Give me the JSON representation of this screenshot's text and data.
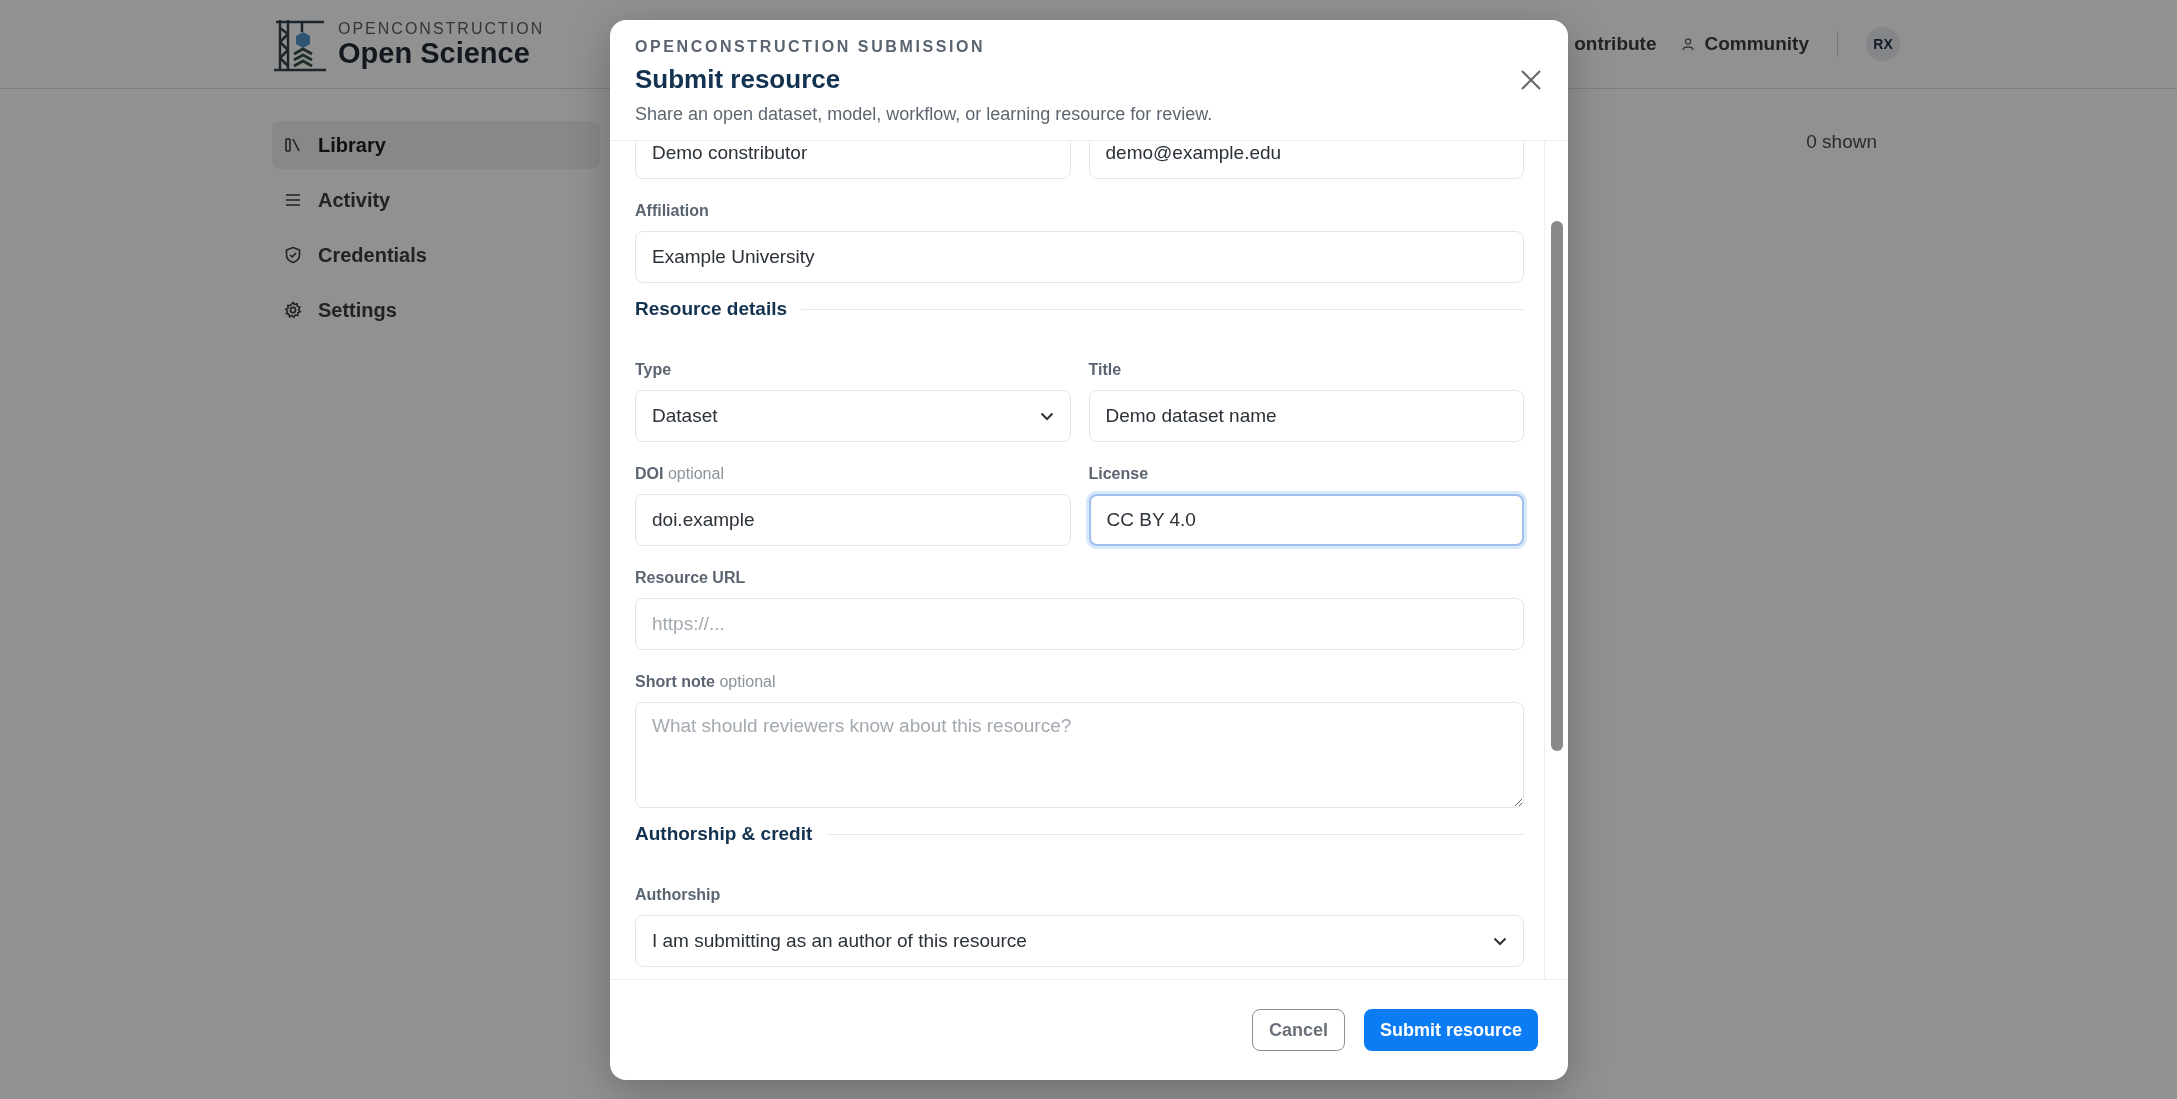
{
  "header": {
    "brand_top": "OPENCONSTRUCTION",
    "brand_name": "Open Science",
    "nav": [
      {
        "label": "ontribute"
      },
      {
        "label": "Community"
      }
    ],
    "avatar": "RX"
  },
  "sidebar": {
    "items": [
      {
        "label": "Library",
        "selected": true
      },
      {
        "label": "Activity",
        "selected": false
      },
      {
        "label": "Credentials",
        "selected": false
      },
      {
        "label": "Settings",
        "selected": false
      }
    ]
  },
  "content": {
    "count": "0 shown"
  },
  "dialog": {
    "eyebrow": "OPENCONSTRUCTION SUBMISSION",
    "title": "Submit resource",
    "subtitle": "Share an open dataset, model, workflow, or learning resource for review.",
    "rows": [
      [
        {
          "kind": "input",
          "value": "Demo constributor",
          "focused": false
        },
        {
          "kind": "input",
          "value": "demo@example.edu",
          "focused": false
        }
      ],
      [
        {
          "kind": "input",
          "label": "Affiliation",
          "value": "Example University",
          "focused": false
        }
      ],
      [
        {
          "kind": "heading",
          "label": "Resource details"
        }
      ],
      [
        {
          "kind": "select",
          "label": "Type",
          "value": "Dataset",
          "focused": false
        },
        {
          "kind": "input",
          "label": "Title",
          "value": "Demo dataset name",
          "focused": false
        }
      ],
      [
        {
          "kind": "input",
          "label": "DOI",
          "note": "optional",
          "value": "doi.example",
          "focused": false
        },
        {
          "kind": "input",
          "label": "License",
          "value": "CC BY 4.0",
          "focused": true
        }
      ],
      [
        {
          "kind": "input",
          "label": "Resource URL",
          "placeholder": "https://...",
          "focused": false
        }
      ],
      [
        {
          "kind": "textarea",
          "label": "Short note",
          "note": "optional",
          "placeholder": "What should reviewers know about this resource?",
          "focused": false
        }
      ],
      [
        {
          "kind": "heading",
          "label": "Authorship & credit"
        }
      ],
      [
        {
          "kind": "select",
          "label": "Authorship",
          "value": "I am submitting as an author of this resource",
          "focused": false
        }
      ]
    ],
    "buttons": [
      {
        "label": "Cancel",
        "kind": "secondary"
      },
      {
        "label": "Submit resource",
        "kind": "primary"
      }
    ]
  }
}
